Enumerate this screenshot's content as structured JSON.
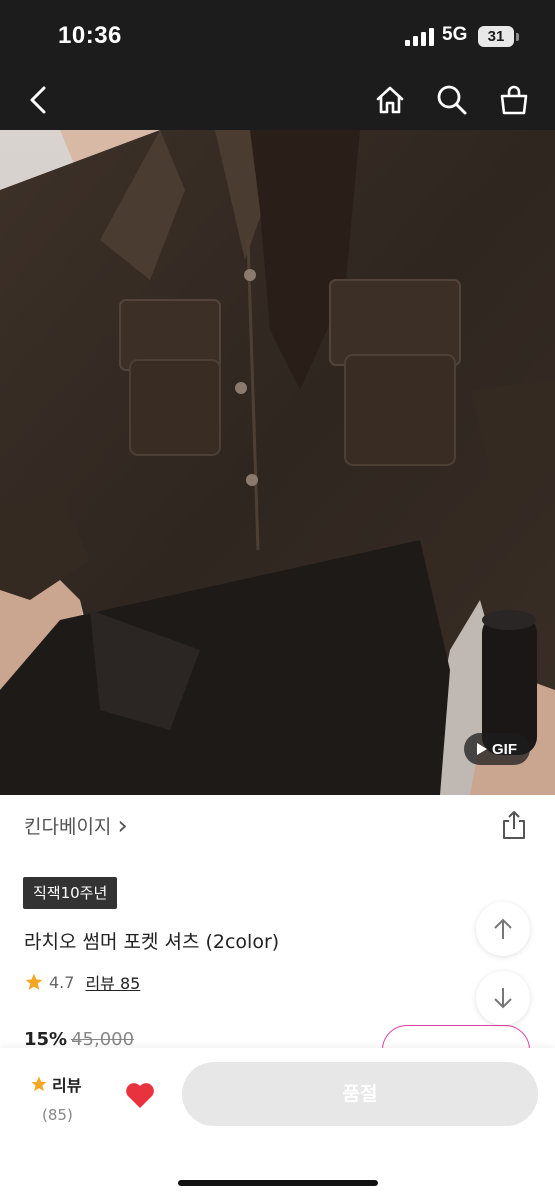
{
  "status": {
    "time": "10:36",
    "network": "5G",
    "battery": "31"
  },
  "icons": {
    "back": "back-chevron-icon",
    "home": "home-icon",
    "search": "search-icon",
    "cart": "shopping-bag-icon",
    "share": "share-icon",
    "scroll_up": "arrow-up-icon",
    "scroll_down": "arrow-down-icon",
    "like": "heart-icon",
    "rating_star": "star-icon"
  },
  "product": {
    "gif_label": "GIF",
    "brand": "킨다베이지",
    "brand_arrow": "›",
    "tag": "직잭10주년",
    "title": "라치오 썸머 포켓 셔츠 (2color)",
    "rating": "4.7",
    "review_link": "리뷰 85",
    "discount": "15%",
    "original_price": "45,000"
  },
  "bottom": {
    "review_label": "리뷰",
    "review_count": "(85)",
    "buy_button": "품절"
  },
  "colors": {
    "dark_bar": "#1c1c1c",
    "heart": "#e8323e",
    "star": "#f5a623",
    "coupon_border": "#e040a0",
    "soldout_bg": "#e7e7e7"
  }
}
